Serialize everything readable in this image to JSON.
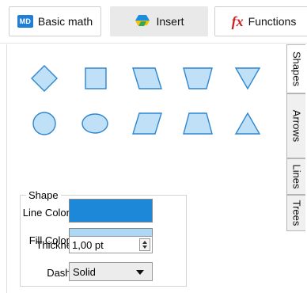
{
  "toolbar": {
    "basic_math": {
      "icon_text": "MD",
      "label": "Basic math"
    },
    "insert": {
      "label": "Insert"
    },
    "functions": {
      "icon_text": "fx",
      "label": "Functions"
    }
  },
  "shapes": [
    {
      "name": "diamond-shape"
    },
    {
      "name": "square-shape"
    },
    {
      "name": "parallelogram-right-shape"
    },
    {
      "name": "trapezoid-inverted-shape"
    },
    {
      "name": "triangle-down-shape"
    },
    {
      "name": "circle-shape"
    },
    {
      "name": "ellipse-shape"
    },
    {
      "name": "parallelogram-left-shape"
    },
    {
      "name": "trapezoid-shape"
    },
    {
      "name": "triangle-up-shape"
    }
  ],
  "side_tabs": [
    "Shapes",
    "Arrows",
    "Lines",
    "Trees"
  ],
  "shape_panel": {
    "title": "Shape",
    "line_color_label": "Line Color",
    "line_color": "#1e88d8",
    "fill_color_label": "Fill Color",
    "fill_color": "#acd8f6",
    "thickness_label": "Thickness",
    "thickness_value": "1,00 pt",
    "dashed_label": "Dashed",
    "dashed_value": "Solid"
  },
  "colors": {
    "shape_fill": "#bfe0f7",
    "shape_stroke": "#2d86cf",
    "accent": "#1f7fd6"
  }
}
